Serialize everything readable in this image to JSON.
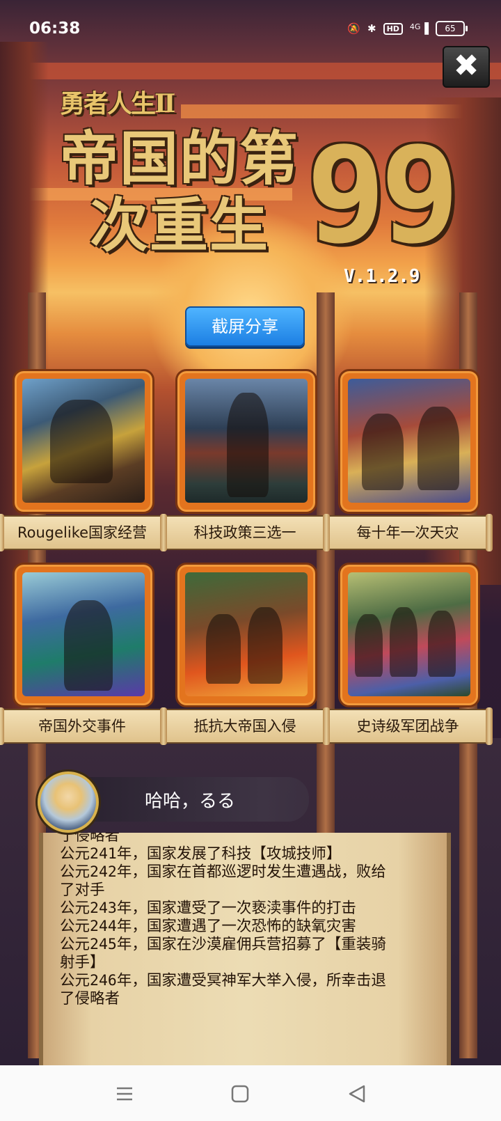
{
  "status_bar": {
    "time": "06:38",
    "network": "4G",
    "hd": "HD",
    "battery": "65"
  },
  "title": {
    "subtitle": "勇者人生Ⅱ",
    "main": "帝国的第 次重生",
    "main_line1": "帝国的第",
    "main_line2": "次重生",
    "number": "99",
    "version": "V.1.2.9"
  },
  "share_button": "截屏分享",
  "cards": [
    {
      "label": "Rougelike国家经营",
      "art": "village"
    },
    {
      "label": "科技政策三选一",
      "art": "statue"
    },
    {
      "label": "每十年一次天灾",
      "art": "knights-battle"
    },
    {
      "label": "帝国外交事件",
      "art": "shield-knight"
    },
    {
      "label": "抵抗大帝国入侵",
      "art": "burning-battle"
    },
    {
      "label": "史诗级军团战争",
      "art": "army-march"
    }
  ],
  "speech": {
    "text": "哈哈，るる"
  },
  "log": [
    "了侵略者",
    "公元241年，国家发展了科技【攻城技师】",
    "公元242年，国家在首都巡逻时发生遭遇战，败给",
    "了对手",
    "公元243年，国家遭受了一次亵渎事件的打击",
    "公元244年，国家遭遇了一次恐怖的缺氧灾害",
    "公元245年，国家在沙漠雇佣兵营招募了【重装骑",
    "射手】",
    "公元246年，国家遭受冥神军大举入侵，所幸击退",
    "了侵略者"
  ],
  "colors": {
    "share_button": "#1c7fe3",
    "card_frame": "#e3741e",
    "title_gold": "#e9c879"
  }
}
